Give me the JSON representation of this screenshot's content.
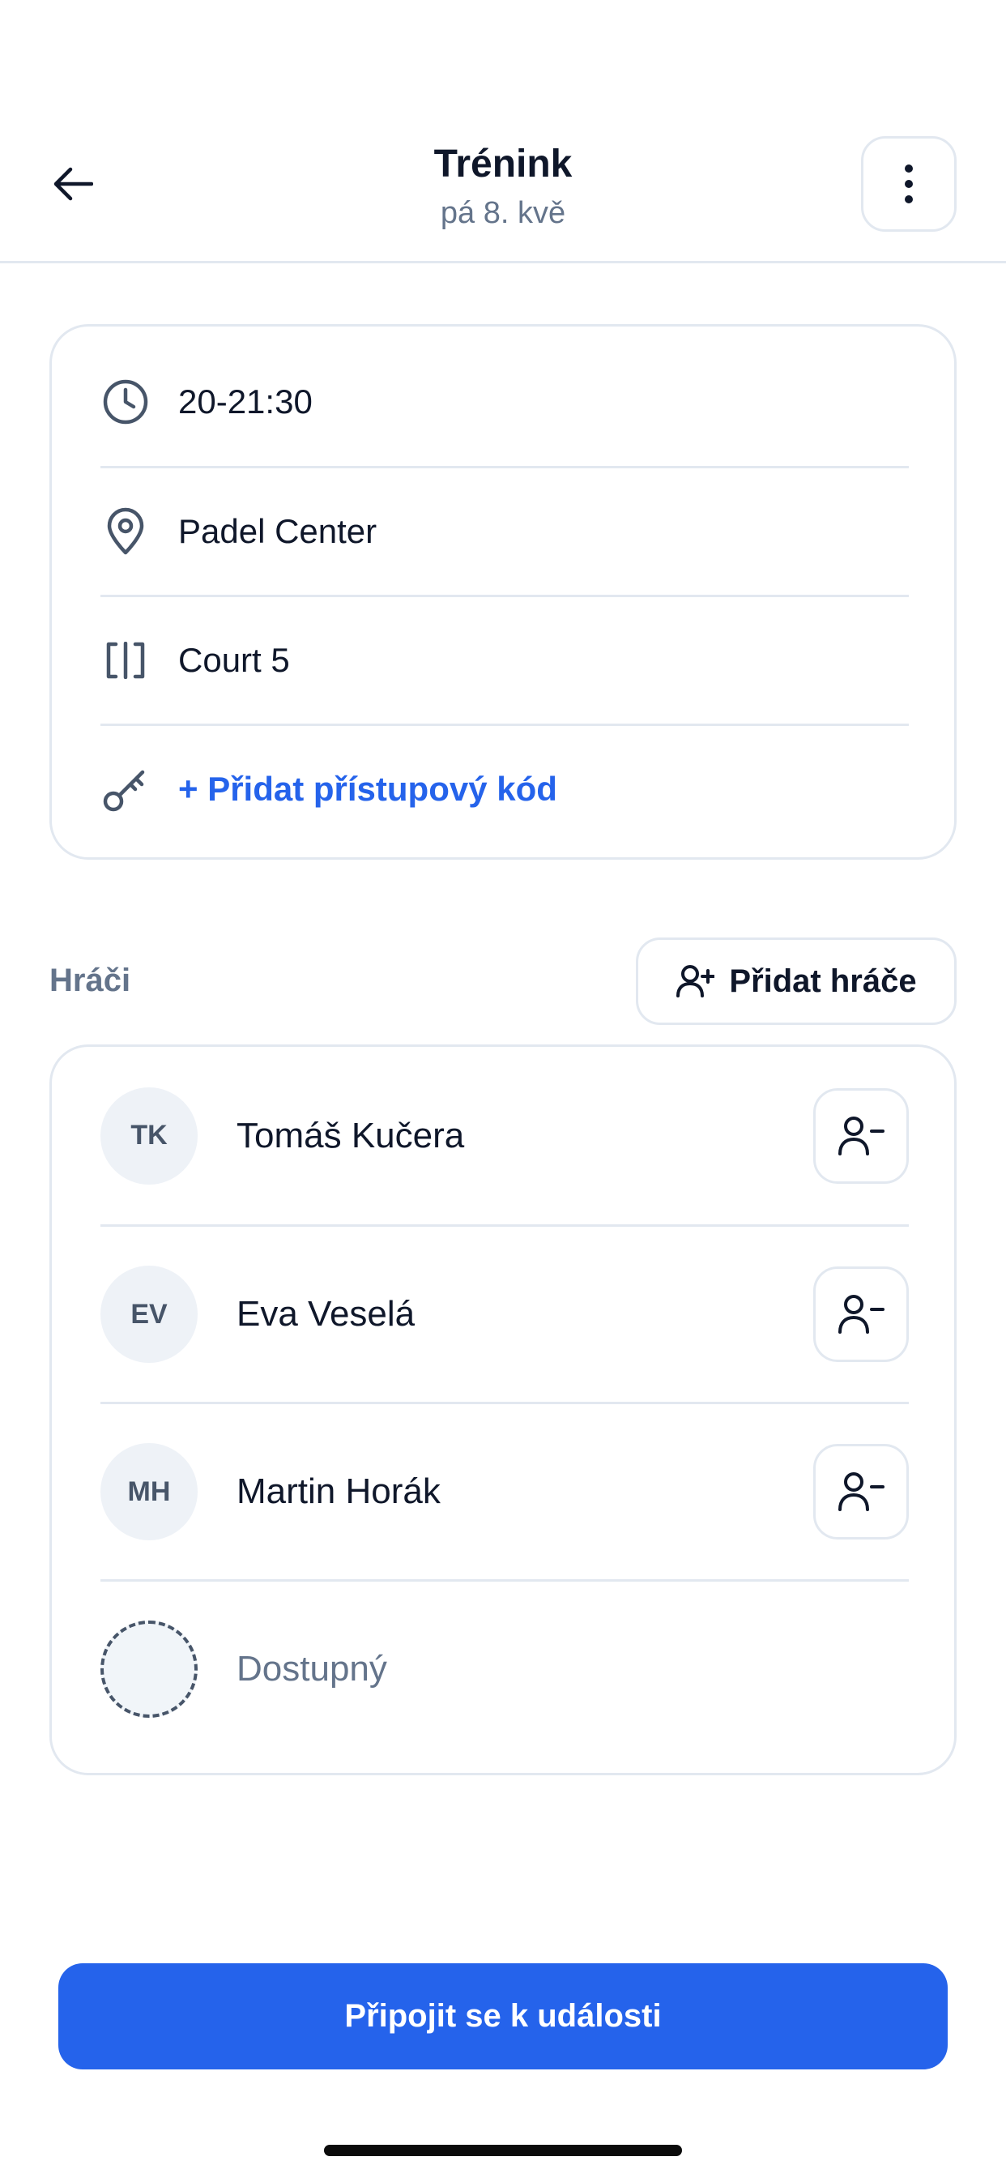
{
  "header": {
    "title": "Trénink",
    "subtitle": "pá 8. kvě",
    "back_icon": "arrow-left-icon",
    "more_icon": "more-vertical-icon"
  },
  "info": {
    "time": "20-21:30",
    "location": "Padel Center",
    "court": "Court 5",
    "access_code_action": "+ Přidat přístupový kód"
  },
  "players_section": {
    "label": "Hráči",
    "add_button_label": "Přidat hráče",
    "players": [
      {
        "initials": "TK",
        "name": "Tomáš Kučera"
      },
      {
        "initials": "EV",
        "name": "Eva Veselá"
      },
      {
        "initials": "MH",
        "name": "Martin Horák"
      }
    ],
    "open_slot_label": "Dostupný"
  },
  "join_button_label": "Připojit se k události",
  "colors": {
    "accent": "#2563eb",
    "text": "#0f172a",
    "muted": "#64748b",
    "border": "#e2e8f0"
  }
}
